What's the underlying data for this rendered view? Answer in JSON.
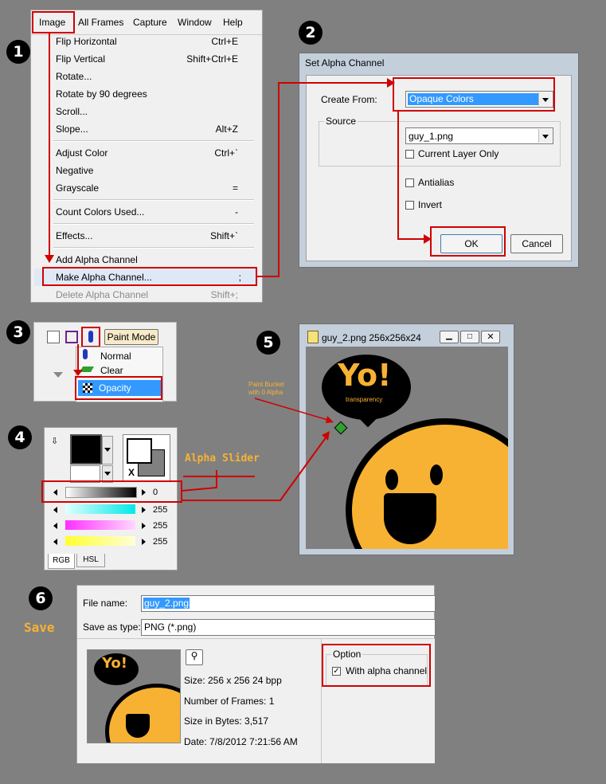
{
  "steps": [
    "1",
    "2",
    "3",
    "4",
    "5",
    "6"
  ],
  "menu": {
    "bar": [
      "Image",
      "All Frames",
      "Capture",
      "Window",
      "Help"
    ],
    "items": [
      {
        "label": "Flip Horizontal",
        "shortcut": "Ctrl+E"
      },
      {
        "label": "Flip Vertical",
        "shortcut": "Shift+Ctrl+E"
      },
      {
        "label": "Rotate...",
        "shortcut": ""
      },
      {
        "label": "Rotate by 90 degrees",
        "shortcut": ""
      },
      {
        "label": "Scroll...",
        "shortcut": ""
      },
      {
        "label": "Slope...",
        "shortcut": "Alt+Z"
      },
      {
        "label": "Adjust Color",
        "shortcut": "Ctrl+`"
      },
      {
        "label": "Negative",
        "shortcut": ""
      },
      {
        "label": "Grayscale",
        "shortcut": "="
      },
      {
        "label": "Count Colors Used...",
        "shortcut": "-"
      },
      {
        "label": "Effects...",
        "shortcut": "Shift+`"
      },
      {
        "label": "Add Alpha Channel",
        "shortcut": ""
      },
      {
        "label": "Make Alpha Channel...",
        "shortcut": ";"
      },
      {
        "label": "Delete Alpha Channel",
        "shortcut": "Shift+;"
      }
    ]
  },
  "dialog": {
    "title": "Set Alpha Channel",
    "create_from_label": "Create From:",
    "create_from_value": "Opaque Colors",
    "source_label": "Source",
    "source_value": "guy_1.png",
    "current_layer_only": "Current Layer Only",
    "antialias": "Antialias",
    "invert": "Invert",
    "ok": "OK",
    "cancel": "Cancel"
  },
  "paint_mode": {
    "button": "Paint Mode",
    "options": [
      "Normal",
      "Clear",
      "Opacity"
    ]
  },
  "color_panel": {
    "alpha_value": "0",
    "cyan_value": "255",
    "magenta_value": "255",
    "yellow_value": "255",
    "swap_label": "X",
    "tabs": [
      "RGB",
      "HSL"
    ],
    "alpha_label": "Alpha Slider"
  },
  "image_window": {
    "title": "guy_2.png 256x256x24",
    "bubble_text": "Yo!",
    "bubble_sub": "transparency",
    "annotation": "Paint Bucket\nwith 0 Alpha"
  },
  "save": {
    "label": "Save",
    "file_name_label": "File name:",
    "file_name_value": "guy_2.png",
    "save_type_label": "Save as type:",
    "save_type_value": "PNG (*.png)",
    "size": "Size: 256 x 256  24 bpp",
    "frames": "Number of Frames: 1",
    "bytes": "Size in Bytes: 3,517",
    "date": "Date: 7/8/2012 7:21:56 AM",
    "option_label": "Option",
    "with_alpha": "With alpha channel"
  },
  "colors": {
    "accent_red": "#d00000",
    "highlight": "#3399ff",
    "face": "#f7b233",
    "yo_text": "#f7b233"
  }
}
